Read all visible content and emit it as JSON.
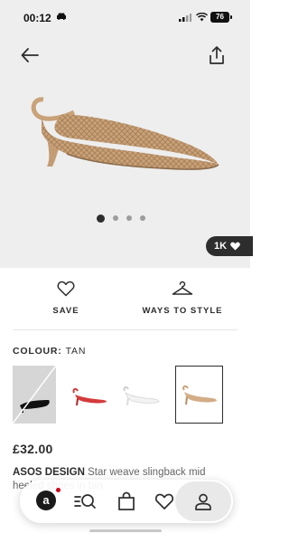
{
  "status_bar": {
    "time": "00:12",
    "battery": "76"
  },
  "hero": {
    "image_alt": "Tan woven slingback kitten heel shoe",
    "active_slide": 1,
    "slide_count": 4,
    "likes": "1K"
  },
  "actions": {
    "save_label": "SAVE",
    "style_label": "WAYS TO STYLE"
  },
  "colour": {
    "label": "COLOUR:",
    "value": "TAN"
  },
  "swatches": [
    {
      "name": "black",
      "available": false
    },
    {
      "name": "red",
      "available": true
    },
    {
      "name": "white",
      "available": true
    },
    {
      "name": "tan",
      "available": true,
      "selected": true
    }
  ],
  "product": {
    "price": "£32.00",
    "brand": "ASOS DESIGN",
    "name": "Star weave slingback mid heeled shoes in tan"
  },
  "nav": {
    "home_icon_letter": "a",
    "items": [
      "home-icon",
      "search-icon",
      "bag-icon",
      "heart-icon",
      "account-icon"
    ]
  },
  "colors": {
    "dark": "#2d2d2d",
    "accent_red": "#d0021b",
    "hero_bg": "#eeeeee"
  }
}
